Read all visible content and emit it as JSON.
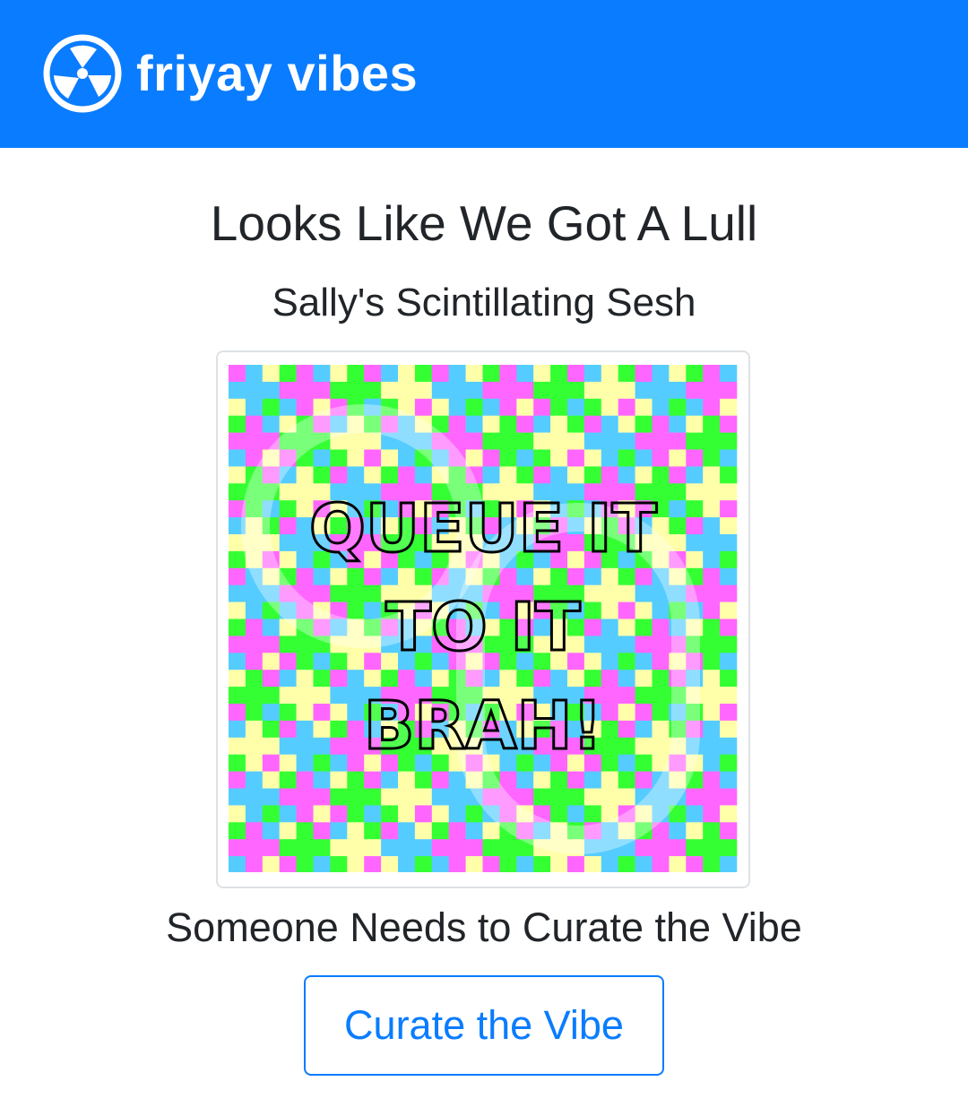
{
  "header": {
    "brand": "friyay vibes",
    "logo_icon": "fan-icon",
    "background": "#0a7cff"
  },
  "main": {
    "title": "Looks Like We Got A Lull",
    "session_name": "Sally's Scintillating Sesh",
    "image_lines": [
      "QUEUE IT",
      "TO IT",
      "BRAH!"
    ],
    "image_palette": [
      "#ff66ff",
      "#33ff33",
      "#ffffaa",
      "#55ccff"
    ],
    "message": "Someone Needs to Curate the Vibe",
    "cta_label": "Curate the Vibe"
  },
  "colors": {
    "accent": "#0a7cff",
    "text": "#212529"
  }
}
